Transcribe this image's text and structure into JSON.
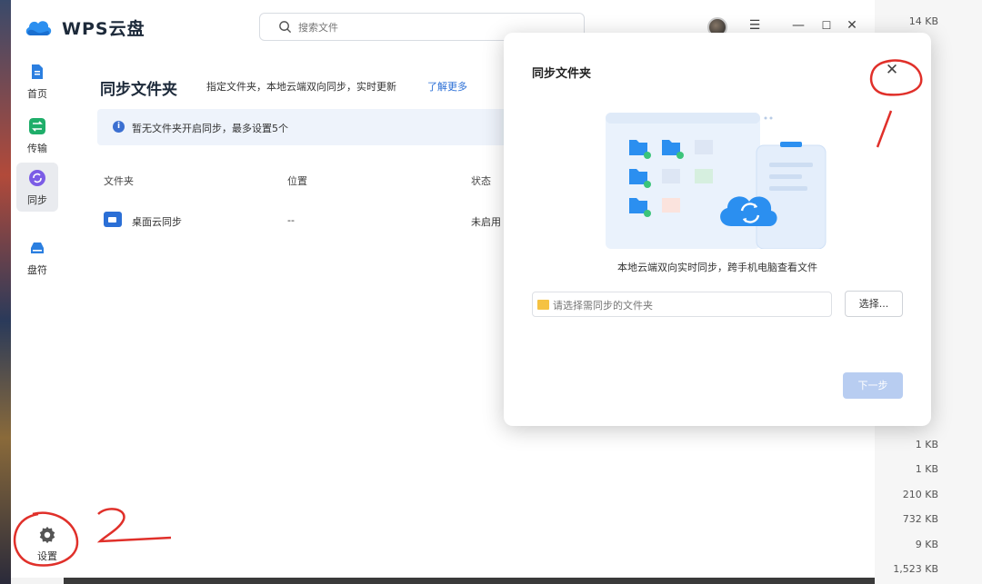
{
  "app": {
    "title": "WPS云盘"
  },
  "search": {
    "placeholder": "搜索文件"
  },
  "sidebar": {
    "items": [
      {
        "label": "首页",
        "icon": "home-doc-icon",
        "color": "#2b7fe0"
      },
      {
        "label": "传输",
        "icon": "transfer-icon",
        "color": "#1fae6a"
      },
      {
        "label": "同步",
        "icon": "sync-icon",
        "color": "#7b5ce6",
        "active": true
      },
      {
        "label": "盘符",
        "icon": "drive-icon",
        "color": "#2b7fe0"
      }
    ],
    "settings_label": "设置"
  },
  "main": {
    "title": "同步文件夹",
    "description": "指定文件夹，本地云端双向同步，实时更新",
    "learn_more": "了解更多",
    "notice": "暂无文件夹开启同步，最多设置5个",
    "columns": [
      "文件夹",
      "位置",
      "状态"
    ],
    "rows": [
      {
        "name": "桌面云同步",
        "location": "--",
        "status": "未启用"
      }
    ]
  },
  "dialog": {
    "title": "同步文件夹",
    "caption": "本地云端双向实时同步，跨手机电脑查看文件",
    "folder_placeholder": "请选择需同步的文件夹",
    "choose_label": "选择...",
    "next_label": "下一步"
  },
  "annotations": {
    "mark_1": "1",
    "mark_2": "2"
  },
  "background_sizes": [
    "14 KB",
    "1 KB",
    "1 KB",
    "210 KB",
    "732 KB",
    "9 KB",
    "1,523 KB"
  ],
  "colors": {
    "accent": "#2b6fd6",
    "notice_bg": "#eef3fb",
    "next_disabled": "#b8cdf1",
    "annotation": "#e0302a"
  }
}
